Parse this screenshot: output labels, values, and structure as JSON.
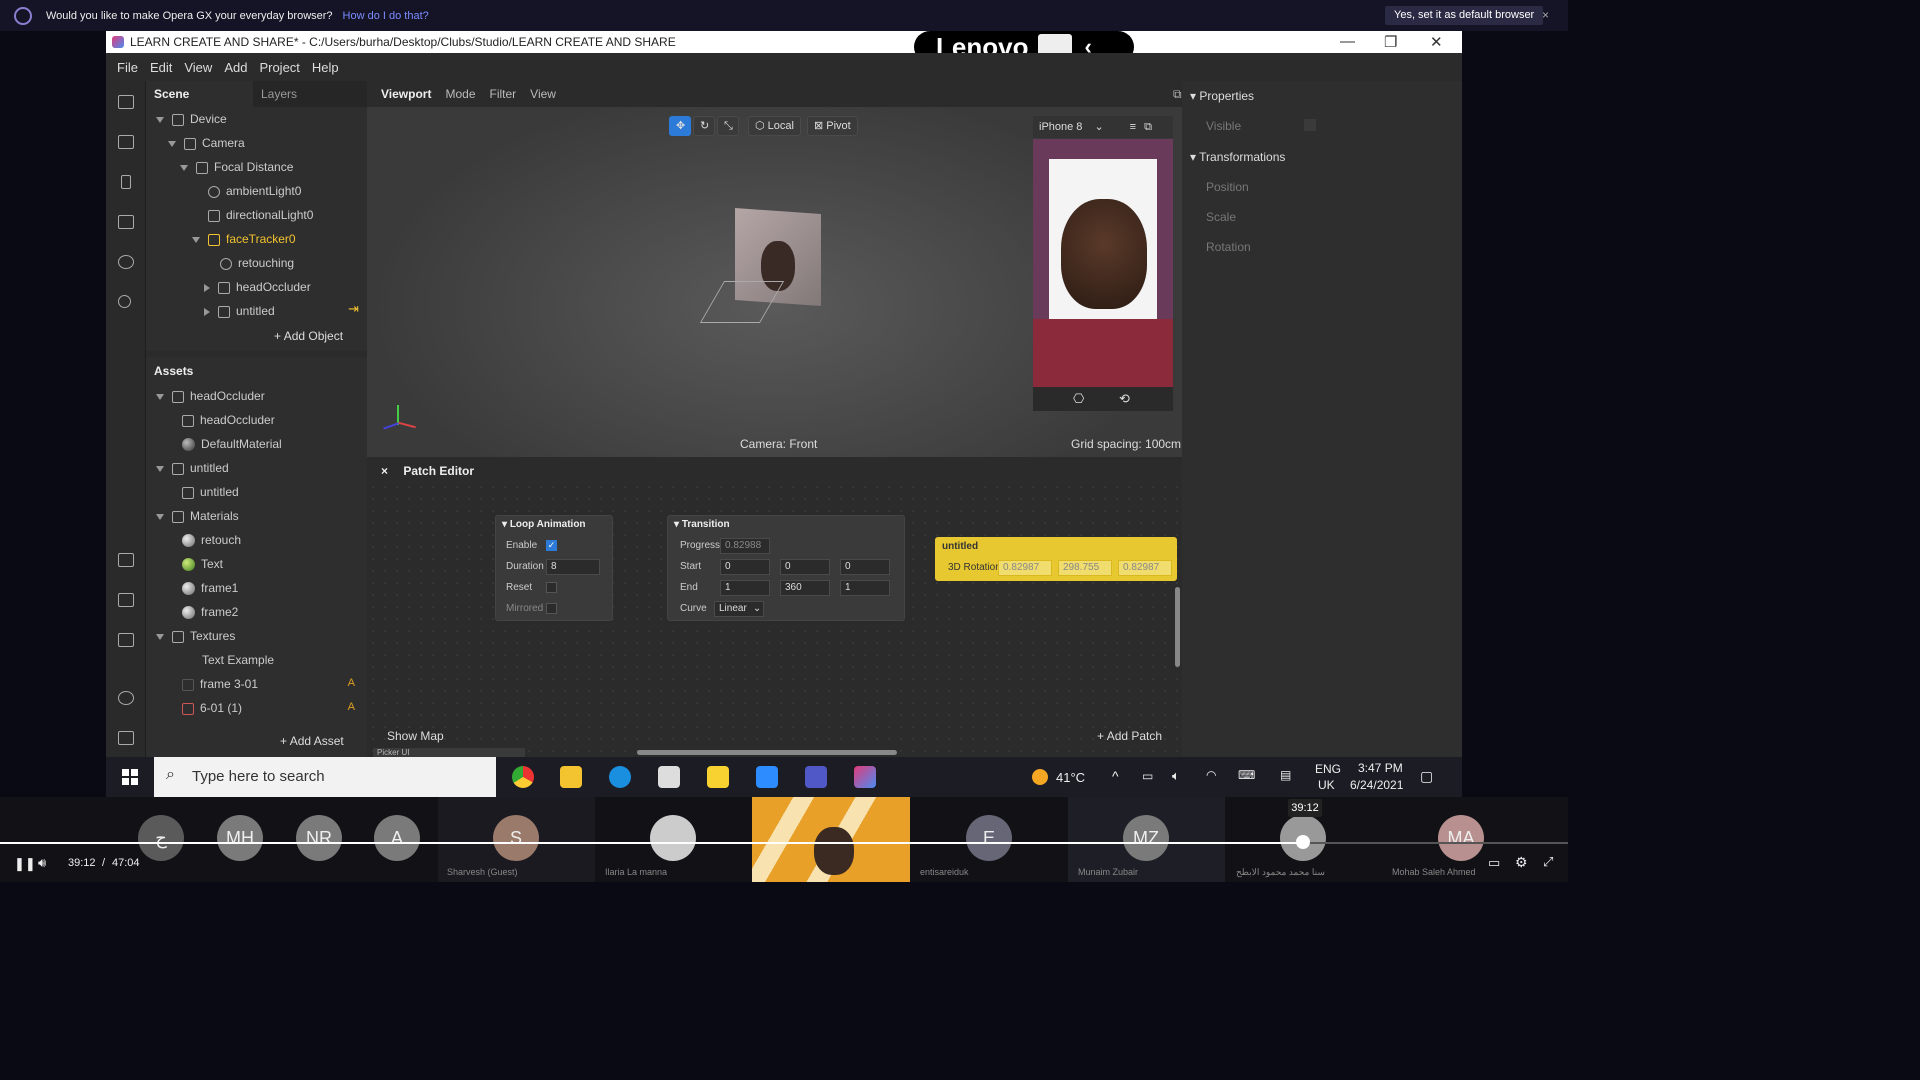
{
  "opera": {
    "question": "Would you like to make Opera GX your everyday browser?",
    "how_link": "How do I do that?",
    "yes_button": "Yes, set it as default browser",
    "close": "×"
  },
  "window": {
    "title": "LEARN CREATE AND SHARE* - C:/Users/burha/Desktop/Clubs/Studio/LEARN CREATE AND SHARE",
    "lenovo_logo": "Lenovo",
    "controls": [
      "—",
      "❐",
      "✕"
    ]
  },
  "menu": [
    "File",
    "Edit",
    "View",
    "Add",
    "Project",
    "Help"
  ],
  "scene": {
    "tabs": [
      "Scene",
      "Layers"
    ],
    "tree": [
      "Device",
      "Camera",
      "Focal Distance",
      "ambientLight0",
      "directionalLight0",
      "faceTracker0",
      "retouching",
      "headOccluder",
      "untitled"
    ],
    "add_object": "Add Object"
  },
  "assets": {
    "header": "Assets",
    "items": [
      "headOccluder",
      "headOccluder",
      "DefaultMaterial",
      "untitled",
      "untitled",
      "Materials",
      "retouch",
      "Text",
      "frame1",
      "frame2",
      "Textures",
      "Text Example",
      "frame 3-01",
      "6-01 (1)"
    ],
    "flag": "A",
    "add_asset": "Add Asset"
  },
  "viewport": {
    "tabs": [
      "Viewport",
      "Mode",
      "Filter",
      "View"
    ],
    "local": "Local",
    "pivot": "Pivot",
    "device": "iPhone 8",
    "camera_label": "Camera: Front",
    "grid_label": "Grid spacing: 100cm"
  },
  "patch_editor": {
    "title": "Patch Editor",
    "close": "×",
    "show_map": "Show Map",
    "add_patch": "Add Patch",
    "picker": "Picker UI",
    "loop": {
      "title": "Loop Animation",
      "enable": "Enable",
      "duration": "Duration",
      "duration_value": "8",
      "reset": "Reset",
      "mirrored": "Mirrored"
    },
    "transition": {
      "title": "Transition",
      "progress": "Progress",
      "progress_value": "0.82988",
      "start": "Start",
      "start_values": [
        "0",
        "0",
        "0"
      ],
      "end": "End",
      "end_values": [
        "1",
        "360",
        "1"
      ],
      "curve": "Curve",
      "curve_value": "Linear"
    },
    "untitled_node": {
      "title": "untitled",
      "port": "3D Rotation",
      "values": [
        "0.82987",
        "298.755",
        "0.82987"
      ]
    }
  },
  "properties": {
    "header": "Properties",
    "visible": "Visible",
    "transformations": "Transformations",
    "position": "Position",
    "scale": "Scale",
    "rotation": "Rotation"
  },
  "taskbar": {
    "search_placeholder": "Type here to search",
    "temp": "41°C",
    "lang": "ENG",
    "region": "UK",
    "time": "3:47 PM",
    "date": "6/24/2021"
  },
  "meeting": {
    "participants": [
      {
        "initials": "ح",
        "name": ""
      },
      {
        "initials": "MH",
        "name": ""
      },
      {
        "initials": "NR",
        "name": ""
      },
      {
        "initials": "A",
        "name": ""
      },
      {
        "initials": "S",
        "name": "Sharvesh (Guest)"
      },
      {
        "initials": "",
        "name": "Ilaria  La manna"
      },
      {
        "initials": "",
        "name": ""
      },
      {
        "initials": "E",
        "name": "entisareiduk"
      },
      {
        "initials": "MZ",
        "name": "Munaim Zubair"
      },
      {
        "initials": "",
        "name": "سنا محمد محمود الابطح"
      },
      {
        "initials": "MA",
        "name": "Mohab   Saleh Ahmed"
      }
    ],
    "tooltip_time": "39:12",
    "current_time": "39:12",
    "separator": "/",
    "total_time": "47:04",
    "progress": 0.833
  }
}
